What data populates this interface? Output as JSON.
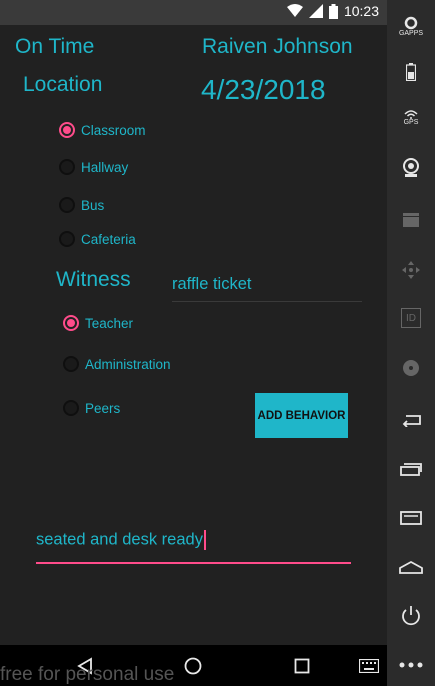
{
  "status_bar": {
    "time": "10:23",
    "icons": [
      "wifi-icon",
      "signal-icon",
      "battery-icon"
    ]
  },
  "header": {
    "status_title": "On Time",
    "student_name": "Raiven Johnson",
    "location_label": "Location",
    "date": "4/23/2018"
  },
  "location": {
    "options": [
      {
        "label": "Classroom",
        "checked": true
      },
      {
        "label": "Hallway",
        "checked": false
      },
      {
        "label": "Bus",
        "checked": false
      },
      {
        "label": "Cafeteria",
        "checked": false
      }
    ]
  },
  "witness": {
    "label": "Witness",
    "options": [
      {
        "label": "Teacher",
        "checked": true
      },
      {
        "label": "Administration",
        "checked": false
      },
      {
        "label": "Peers",
        "checked": false
      }
    ]
  },
  "reward_field": {
    "value": "raffle ticket"
  },
  "add_button": {
    "label": "ADD BEHAVIOR"
  },
  "behavior_field": {
    "value": "seated and desk ready"
  },
  "watermark": "free for personal use",
  "sidebar": {
    "gapps_label": "GAPPS",
    "gps_label": "GPS",
    "id_label": "ID"
  },
  "colors": {
    "accent": "#1fb6c9",
    "highlight": "#ff4c8b",
    "background": "#212121"
  }
}
